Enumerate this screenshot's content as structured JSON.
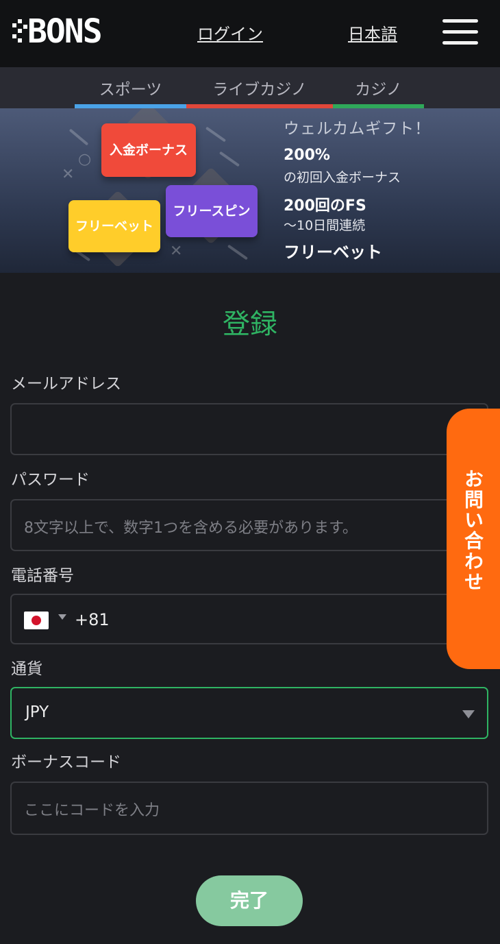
{
  "header": {
    "logo_text": "BONS",
    "login_label": "ログイン",
    "language_label": "日本語",
    "menu_icon": "hamburger-icon"
  },
  "nav": {
    "tabs": [
      {
        "label": "スポーツ",
        "color": "#4aa3e8"
      },
      {
        "label": "ライブカジノ",
        "color": "#e0473a"
      },
      {
        "label": "カジノ",
        "color": "#2fa85a"
      }
    ]
  },
  "banner": {
    "cards": [
      {
        "label": "入金ボーナス",
        "color": "#f04a3a"
      },
      {
        "label": "フリースピン",
        "color": "#7a4fd8"
      },
      {
        "label": "フリーベット",
        "color": "#ffcd2a"
      }
    ],
    "title": "ウェルカムギフト！",
    "line1_big": "200%",
    "line1_small": "の初回入金ボーナス",
    "line2_big": "200回のFS",
    "line2_small": "～10日間連続",
    "line3_big": "フリーベット"
  },
  "form": {
    "title": "登録",
    "email": {
      "label": "メールアドレス",
      "value": "",
      "placeholder": ""
    },
    "password": {
      "label": "パスワード",
      "placeholder": "8文字以上で、数字1つを含める必要があります。"
    },
    "phone": {
      "label": "電話番号",
      "country_flag": "japan-flag-icon",
      "dial_code": "+81"
    },
    "currency": {
      "label": "通貨",
      "selected": "JPY"
    },
    "bonus_code": {
      "label": "ボーナスコード",
      "placeholder": "ここにコードを入力"
    },
    "submit_label": "完了"
  },
  "contact_tab": {
    "label": "お問い合わせ",
    "color": "#ff6a10"
  },
  "colors": {
    "accent": "#2fb463",
    "background": "#1b1c20",
    "header": "#111214"
  }
}
